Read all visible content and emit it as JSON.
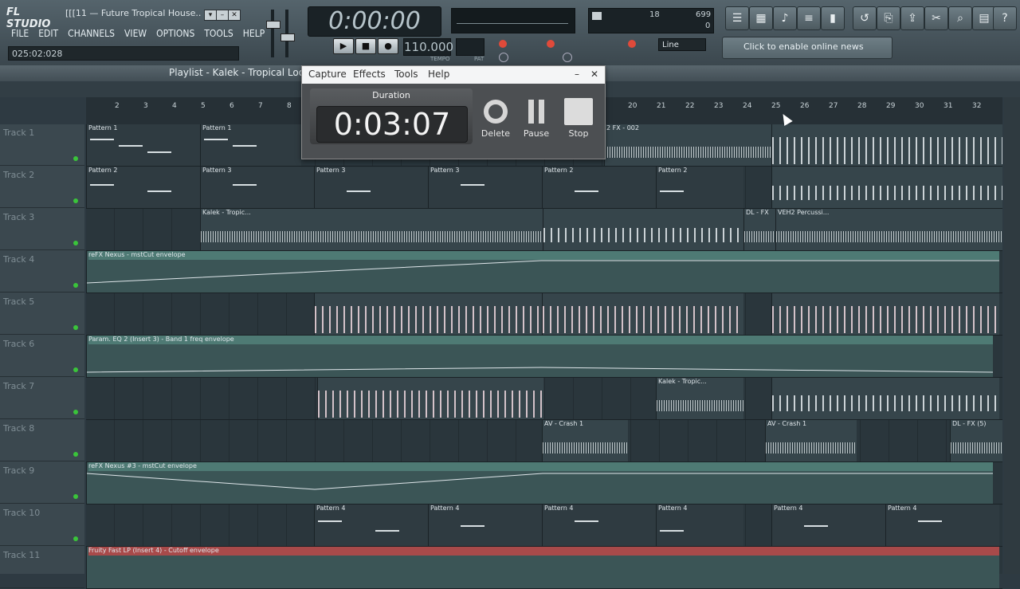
{
  "app": {
    "logo": "FL STUDIO",
    "window_title": "[[[11 — Future Tropical House...",
    "menu": [
      "FILE",
      "EDIT",
      "CHANNELS",
      "VIEW",
      "OPTIONS",
      "TOOLS",
      "HELP"
    ],
    "hint_text": "025:02:028",
    "time_display": "0:00:00",
    "tempo": "110.000",
    "tempo_label": "TEMPO",
    "pat_label": "PAT",
    "snap_value": "Line",
    "news_text": "Click to enable online news",
    "cpu_value": "699",
    "ram_value": "18",
    "poly_value": "0"
  },
  "playlist": {
    "title": "Playlist - Kalek - Tropical Loop",
    "ruler_ticks": [
      "2",
      "3",
      "4",
      "5",
      "6",
      "7",
      "8",
      "20",
      "21",
      "22",
      "23",
      "24",
      "25",
      "26",
      "27",
      "28",
      "29",
      "30",
      "31",
      "32"
    ],
    "tracks": [
      "Track 1",
      "Track 2",
      "Track 3",
      "Track 4",
      "Track 5",
      "Track 6",
      "Track 7",
      "Track 8",
      "Track 9",
      "Track 10",
      "Track 11"
    ],
    "clip_labels": {
      "pattern1": "Pattern 1",
      "pattern2": "Pattern 2",
      "pattern3": "Pattern 3",
      "pattern4": "Pattern 4",
      "fx002": "2 FX - 002",
      "kalek": "Kalek - Tropic...",
      "dlfx": "DL - FX",
      "veh2": "VEH2 Percussi...",
      "env_nexus": "reFX Nexus - mstCut envelope",
      "env_eq": "Param. EQ 2 (Insert 3) - Band 1 freq envelope",
      "kalek7": "Kalek - Tropic...",
      "crash": "AV - Crash 1",
      "dlfx5": "DL - FX (5)",
      "env_nexus3": "reFX Nexus #3 - mstCut envelope",
      "env_lp": "Fruity Fast LP (Insert 4) - Cutoff envelope"
    }
  },
  "capture": {
    "menu": [
      "Capture",
      "Effects",
      "Tools",
      "Help"
    ],
    "duration_label": "Duration",
    "duration_value": "0:03:07",
    "delete_label": "Delete",
    "pause_label": "Pause",
    "stop_label": "Stop"
  }
}
